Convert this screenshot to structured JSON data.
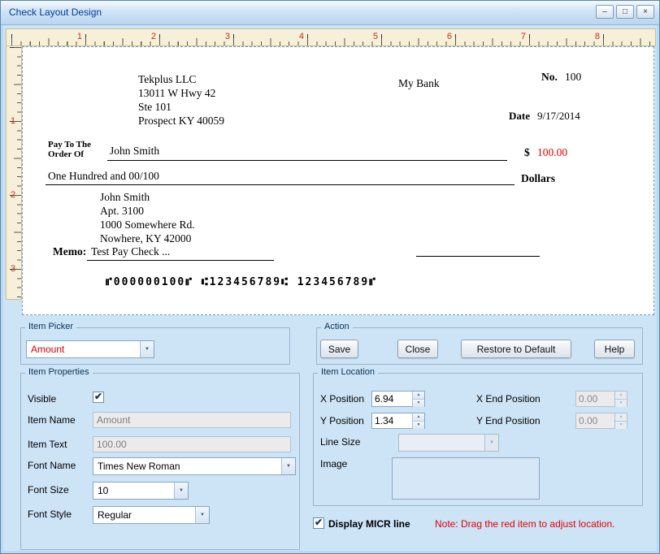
{
  "window": {
    "title": "Check Layout Design"
  },
  "window_controls": {
    "minimize": "–",
    "maximize": "□",
    "close": "×"
  },
  "icons": {
    "dropdown": "▼",
    "spin_up": "▲",
    "spin_down": "▼",
    "check": "✔"
  },
  "ruler": {
    "horizontal_numbers": [
      "1",
      "2",
      "3",
      "4",
      "5",
      "6",
      "7",
      "8"
    ],
    "vertical_numbers": [
      "1",
      "2",
      "3"
    ]
  },
  "check": {
    "company_lines": [
      "Tekplus LLC",
      "13011 W Hwy 42",
      "Ste 101",
      "Prospect KY 40059"
    ],
    "bank_name": "My Bank",
    "check_no_label": "No.",
    "check_no": "100",
    "date_label": "Date",
    "date_value": "9/17/2014",
    "pay_to_line1": "Pay To The",
    "pay_to_line2": "Order Of",
    "payee_name": "John Smith",
    "currency_symbol": "$",
    "amount": "100.00",
    "amount_words": "One Hundred  and 00/100",
    "dollars_label": "Dollars",
    "payee_address_lines": [
      "John Smith",
      "Apt. 3100",
      "1000 Somewhere Rd.",
      "Nowhere, KY 42000"
    ],
    "memo_label": "Memo:",
    "memo_text": "Test Pay Check ...",
    "micr_line": "⑈000000100⑈ ⑆123456789⑆ 123456789⑈"
  },
  "item_picker": {
    "group_label": "Item Picker",
    "selected": "Amount"
  },
  "action": {
    "group_label": "Action",
    "save_label": "Save",
    "close_label": "Close",
    "restore_label": "Restore to Default",
    "help_label": "Help"
  },
  "item_properties": {
    "group_label": "Item Properties",
    "visible_label": "Visible",
    "visible_checked": true,
    "item_name_label": "Item Name",
    "item_name_value": "Amount",
    "item_text_label": "Item Text",
    "item_text_value": "100.00",
    "font_name_label": "Font Name",
    "font_name_value": "Times New Roman",
    "font_size_label": "Font Size",
    "font_size_value": "10",
    "font_style_label": "Font Style",
    "font_style_value": "Regular"
  },
  "item_location": {
    "group_label": "Item Location",
    "x_position_label": "X Position",
    "x_position_value": "6.94",
    "x_end_label": "X End Position",
    "x_end_value": "0.00",
    "y_position_label": "Y Position",
    "y_position_value": "1.34",
    "y_end_label": "Y End Position",
    "y_end_value": "0.00",
    "line_size_label": "Line Size",
    "line_size_value": "",
    "image_label": "Image"
  },
  "footer": {
    "micr_checkbox_label": "Display MICR line",
    "micr_checked": true,
    "note": "Note:  Drag the red item to adjust location."
  },
  "colors": {
    "accent_red": "#e00000",
    "panel_blue": "#cde3f6",
    "ruler_cream": "#f7f0d8",
    "title_text": "#003a9e"
  }
}
